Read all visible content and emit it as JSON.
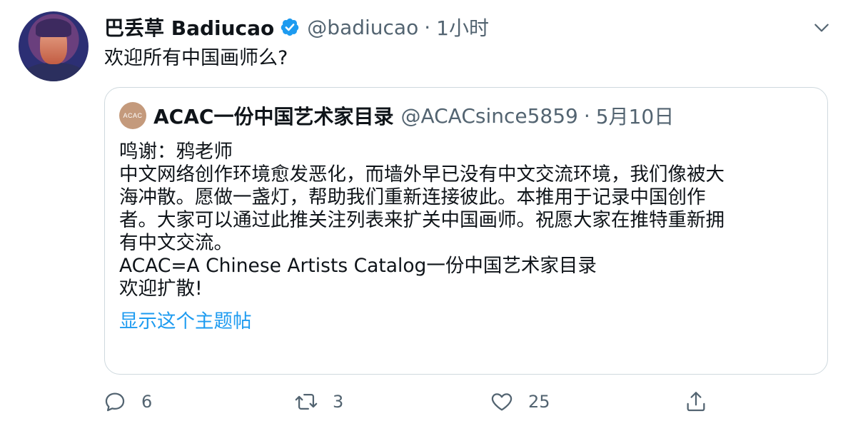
{
  "author": {
    "name": "巴丢草 Badiucao",
    "handle": "@badiucao",
    "separator": "·",
    "time": "1小时",
    "avatar_icon": "avatar-painting"
  },
  "tweet": {
    "text": "欢迎所有中国画师么?"
  },
  "quote": {
    "avatar_text": "ACAC",
    "name": "ACAC一份中国艺术家目录",
    "handle": "@ACACsince5859",
    "separator": "·",
    "date": "5月10日",
    "lines": [
      "鸣谢：鸦老师",
      "中文网络创作环境愈发恶化，而墙外早已没有中文交流环境，我们像被大",
      "海冲散。愿做一盏灯，帮助我们重新连接彼此。本推用于记录中国创作",
      "者。大家可以通过此推关注列表来扩关中国画师。祝愿大家在推特重新拥",
      "有中文交流。",
      "ACAC=A Chinese Artists Catalog一份中国艺术家目录",
      "欢迎扩散!"
    ],
    "show_thread": "显示这个主题帖"
  },
  "actions": {
    "reply_count": "6",
    "retweet_count": "3",
    "like_count": "25"
  },
  "colors": {
    "verified": "#1d9bf0",
    "link": "#1d9bf0",
    "muted": "#536471",
    "border": "#cfd9de"
  }
}
